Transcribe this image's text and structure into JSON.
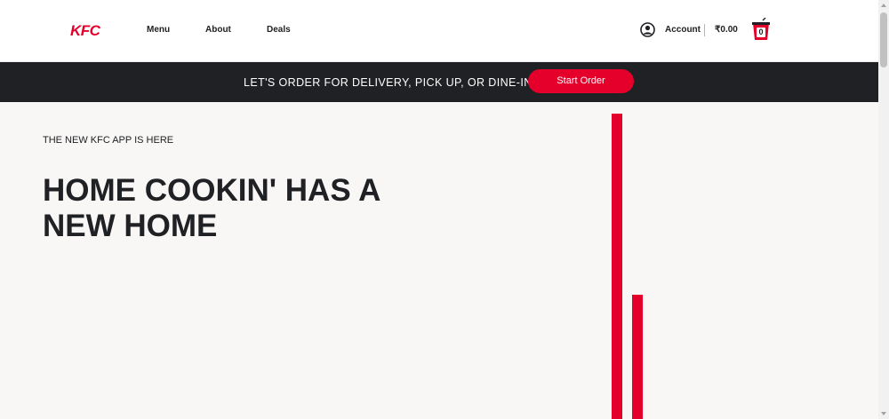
{
  "header": {
    "logo": "KFC",
    "nav": [
      "Menu",
      "About",
      "Deals"
    ],
    "account_label": "Account",
    "cart_total": "₹0.00",
    "cart_count": "0",
    "icons": {
      "account": "account-icon",
      "cart": "bucket-icon"
    }
  },
  "order_bar": {
    "text": "LET'S ORDER FOR DELIVERY, PICK UP, OR DINE-IN",
    "button_label": "Start Order"
  },
  "hero": {
    "kicker": "THE NEW KFC APP IS HERE",
    "headline": "HOME COOKIN' HAS A NEW HOME"
  },
  "colors": {
    "brand_red": "#e4002b",
    "dark": "#202124",
    "background": "#f8f7f5"
  }
}
